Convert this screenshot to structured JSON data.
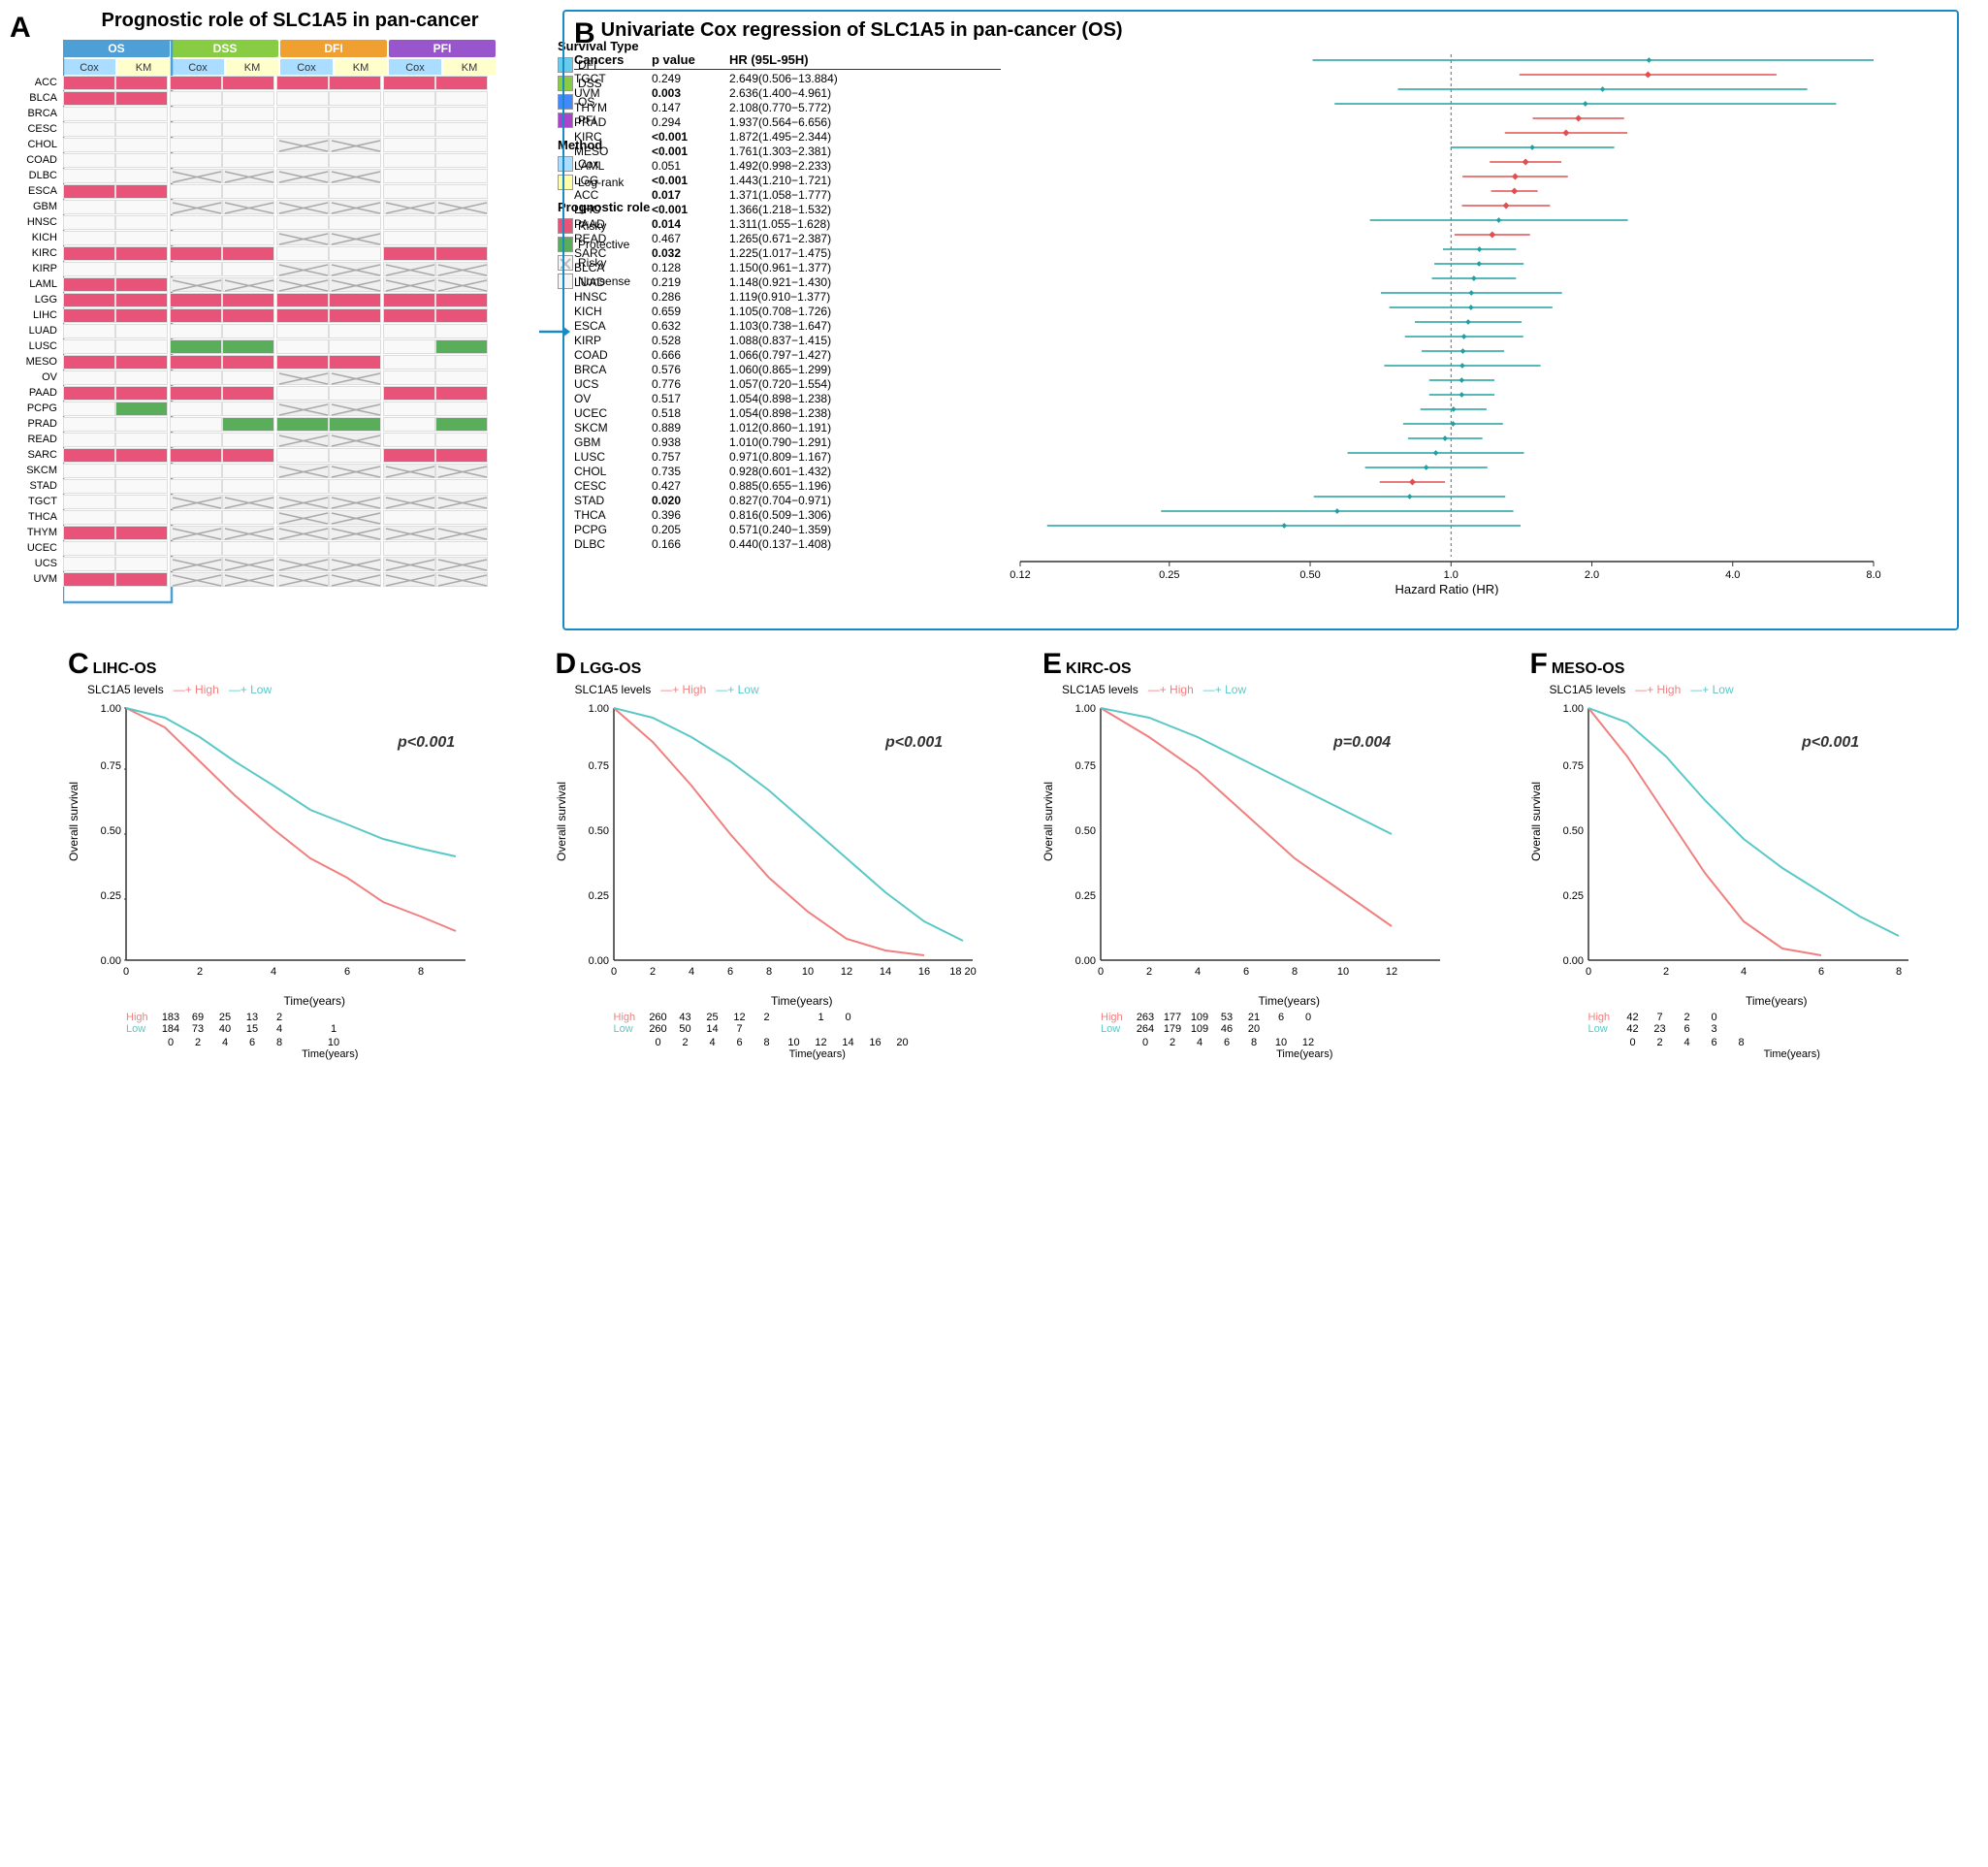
{
  "panelA": {
    "label": "A",
    "title": "Prognostic role of SLC1A5 in pan-cancer",
    "colHeaders": [
      "OS",
      "DSS",
      "DFI",
      "PFI"
    ],
    "subHeaders": [
      "Cox",
      "KM",
      "Cox",
      "KM",
      "Cox",
      "KM",
      "Cox",
      "KM"
    ],
    "rows": [
      {
        "cancer": "ACC",
        "cells": [
          "risky",
          "risky",
          "risky",
          "risky",
          "risky",
          "risky",
          "risky",
          "risky"
        ]
      },
      {
        "cancer": "BLCA",
        "cells": [
          "risky",
          "risky",
          "empty",
          "empty",
          "empty",
          "empty",
          "empty",
          "empty"
        ]
      },
      {
        "cancer": "BRCA",
        "cells": [
          "empty",
          "empty",
          "empty",
          "empty",
          "empty",
          "empty",
          "empty",
          "empty"
        ]
      },
      {
        "cancer": "CESC",
        "cells": [
          "empty",
          "empty",
          "empty",
          "empty",
          "empty",
          "empty",
          "empty",
          "empty"
        ]
      },
      {
        "cancer": "CHOL",
        "cells": [
          "empty",
          "empty",
          "empty",
          "empty",
          "cross",
          "cross",
          "empty",
          "empty"
        ]
      },
      {
        "cancer": "COAD",
        "cells": [
          "empty",
          "empty",
          "empty",
          "empty",
          "empty",
          "empty",
          "empty",
          "empty"
        ]
      },
      {
        "cancer": "DLBC",
        "cells": [
          "empty",
          "empty",
          "cross",
          "cross",
          "cross",
          "cross",
          "empty",
          "empty"
        ]
      },
      {
        "cancer": "ESCA",
        "cells": [
          "risky",
          "risky",
          "empty",
          "empty",
          "empty",
          "empty",
          "empty",
          "empty"
        ]
      },
      {
        "cancer": "GBM",
        "cells": [
          "empty",
          "empty",
          "cross",
          "cross",
          "cross",
          "cross",
          "cross",
          "cross"
        ]
      },
      {
        "cancer": "HNSC",
        "cells": [
          "empty",
          "empty",
          "empty",
          "empty",
          "empty",
          "empty",
          "empty",
          "empty"
        ]
      },
      {
        "cancer": "KICH",
        "cells": [
          "empty",
          "empty",
          "empty",
          "empty",
          "cross",
          "cross",
          "empty",
          "empty"
        ]
      },
      {
        "cancer": "KIRC",
        "cells": [
          "risky",
          "risky",
          "risky",
          "risky",
          "empty",
          "empty",
          "risky",
          "risky"
        ]
      },
      {
        "cancer": "KIRP",
        "cells": [
          "empty",
          "empty",
          "empty",
          "empty",
          "cross",
          "cross",
          "cross",
          "cross"
        ]
      },
      {
        "cancer": "LAML",
        "cells": [
          "risky",
          "risky",
          "cross",
          "cross",
          "cross",
          "cross",
          "cross",
          "cross"
        ]
      },
      {
        "cancer": "LGG",
        "cells": [
          "risky",
          "risky",
          "risky",
          "risky",
          "risky",
          "risky",
          "risky",
          "risky"
        ]
      },
      {
        "cancer": "LIHC",
        "cells": [
          "risky",
          "risky",
          "risky",
          "risky",
          "risky",
          "risky",
          "risky",
          "risky"
        ]
      },
      {
        "cancer": "LUAD",
        "cells": [
          "empty",
          "empty",
          "empty",
          "empty",
          "empty",
          "empty",
          "empty",
          "empty"
        ]
      },
      {
        "cancer": "LUSC",
        "cells": [
          "empty",
          "empty",
          "protective",
          "protective",
          "empty",
          "empty",
          "empty",
          "protective"
        ]
      },
      {
        "cancer": "MESO",
        "cells": [
          "risky",
          "risky",
          "risky",
          "risky",
          "risky",
          "risky",
          "empty",
          "empty"
        ]
      },
      {
        "cancer": "OV",
        "cells": [
          "empty",
          "empty",
          "empty",
          "empty",
          "cross",
          "cross",
          "empty",
          "empty"
        ]
      },
      {
        "cancer": "PAAD",
        "cells": [
          "risky",
          "risky",
          "risky",
          "risky",
          "empty",
          "empty",
          "risky",
          "risky"
        ]
      },
      {
        "cancer": "PCPG",
        "cells": [
          "empty",
          "protective",
          "empty",
          "empty",
          "cross",
          "cross",
          "empty",
          "empty"
        ]
      },
      {
        "cancer": "PRAD",
        "cells": [
          "empty",
          "empty",
          "empty",
          "protective",
          "protective",
          "protective",
          "empty",
          "protective"
        ]
      },
      {
        "cancer": "READ",
        "cells": [
          "empty",
          "empty",
          "empty",
          "empty",
          "cross",
          "cross",
          "empty",
          "empty"
        ]
      },
      {
        "cancer": "SARC",
        "cells": [
          "risky",
          "risky",
          "risky",
          "risky",
          "empty",
          "empty",
          "risky",
          "risky"
        ]
      },
      {
        "cancer": "SKCM",
        "cells": [
          "empty",
          "empty",
          "empty",
          "empty",
          "cross",
          "cross",
          "cross",
          "cross"
        ]
      },
      {
        "cancer": "STAD",
        "cells": [
          "empty",
          "empty",
          "empty",
          "empty",
          "empty",
          "empty",
          "empty",
          "empty"
        ]
      },
      {
        "cancer": "TGCT",
        "cells": [
          "empty",
          "empty",
          "cross",
          "cross",
          "cross",
          "cross",
          "cross",
          "cross"
        ]
      },
      {
        "cancer": "THCA",
        "cells": [
          "empty",
          "empty",
          "empty",
          "empty",
          "cross",
          "cross",
          "empty",
          "empty"
        ]
      },
      {
        "cancer": "THYM",
        "cells": [
          "risky",
          "risky",
          "cross",
          "cross",
          "cross",
          "cross",
          "cross",
          "cross"
        ]
      },
      {
        "cancer": "UCEC",
        "cells": [
          "empty",
          "empty",
          "empty",
          "empty",
          "empty",
          "empty",
          "empty",
          "empty"
        ]
      },
      {
        "cancer": "UCS",
        "cells": [
          "empty",
          "empty",
          "cross",
          "cross",
          "cross",
          "cross",
          "cross",
          "cross"
        ]
      },
      {
        "cancer": "UVM",
        "cells": [
          "risky",
          "risky",
          "cross",
          "cross",
          "cross",
          "cross",
          "cross",
          "cross"
        ]
      }
    ],
    "legendSurvivalType": {
      "title": "Survival Type",
      "items": [
        {
          "label": "DFI",
          "color": "#66ccee"
        },
        {
          "label": "DSS",
          "color": "#88cc44"
        },
        {
          "label": "OS",
          "color": "#4488ff"
        },
        {
          "label": "PFI",
          "color": "#aa44cc"
        }
      ]
    },
    "legendMethod": {
      "title": "Method",
      "items": [
        {
          "label": "Cox",
          "color": "#aaddff"
        },
        {
          "label": "Log-rank",
          "color": "#ffffaa"
        }
      ]
    },
    "legendPrognostic": {
      "title": "Prognostic role",
      "items": [
        {
          "label": "Risky",
          "color": "#e8537a"
        },
        {
          "label": "Protective",
          "color": "#5aad5a"
        },
        {
          "label": "Risky (nonsense border)",
          "color": "#f5f5f5",
          "text": "Risky"
        },
        {
          "label": "Nonsense",
          "color": "#f5f5f5",
          "text": "Nonsense"
        }
      ]
    }
  },
  "panelB": {
    "label": "B",
    "title": "Univariate Cox regression of SLC1A5 in pan-cancer (OS)",
    "headers": {
      "cancer": "Cancers",
      "pvalue": "p value",
      "hr": "HR (95L-95H)"
    },
    "rows": [
      {
        "cancer": "TGCT",
        "pvalue": "0.249",
        "hr": "2.649(0.506−13.884)",
        "sig": false,
        "val": 2.649,
        "low": 0.506,
        "high": 13.884,
        "color": "teal"
      },
      {
        "cancer": "UVM",
        "pvalue": "0.003",
        "hr": "2.636(1.400−4.961)",
        "sig": true,
        "val": 2.636,
        "low": 1.4,
        "high": 4.961,
        "color": "red"
      },
      {
        "cancer": "THYM",
        "pvalue": "0.147",
        "hr": "2.108(0.770−5.772)",
        "sig": false,
        "val": 2.108,
        "low": 0.77,
        "high": 5.772,
        "color": "teal"
      },
      {
        "cancer": "PRAD",
        "pvalue": "0.294",
        "hr": "1.937(0.564−6.656)",
        "sig": false,
        "val": 1.937,
        "low": 0.564,
        "high": 6.656,
        "color": "teal"
      },
      {
        "cancer": "KIRC",
        "pvalue": "<0.001",
        "hr": "1.872(1.495−2.344)",
        "sig": true,
        "val": 1.872,
        "low": 1.495,
        "high": 2.344,
        "color": "red"
      },
      {
        "cancer": "MESO",
        "pvalue": "<0.001",
        "hr": "1.761(1.303−2.381)",
        "sig": true,
        "val": 1.761,
        "low": 1.303,
        "high": 2.381,
        "color": "red"
      },
      {
        "cancer": "LAML",
        "pvalue": "0.051",
        "hr": "1.492(0.998−2.233)",
        "sig": false,
        "val": 1.492,
        "low": 0.998,
        "high": 2.233,
        "color": "teal"
      },
      {
        "cancer": "LGG",
        "pvalue": "<0.001",
        "hr": "1.443(1.210−1.721)",
        "sig": true,
        "val": 1.443,
        "low": 1.21,
        "high": 1.721,
        "color": "red"
      },
      {
        "cancer": "ACC",
        "pvalue": "0.017",
        "hr": "1.371(1.058−1.777)",
        "sig": true,
        "val": 1.371,
        "low": 1.058,
        "high": 1.777,
        "color": "red"
      },
      {
        "cancer": "LIHC",
        "pvalue": "<0.001",
        "hr": "1.366(1.218−1.532)",
        "sig": true,
        "val": 1.366,
        "low": 1.218,
        "high": 1.532,
        "color": "red"
      },
      {
        "cancer": "PAAD",
        "pvalue": "0.014",
        "hr": "1.311(1.055−1.628)",
        "sig": true,
        "val": 1.311,
        "low": 1.055,
        "high": 1.628,
        "color": "red"
      },
      {
        "cancer": "READ",
        "pvalue": "0.467",
        "hr": "1.265(0.671−2.387)",
        "sig": false,
        "val": 1.265,
        "low": 0.671,
        "high": 2.387,
        "color": "teal"
      },
      {
        "cancer": "SARC",
        "pvalue": "0.032",
        "hr": "1.225(1.017−1.475)",
        "sig": true,
        "val": 1.225,
        "low": 1.017,
        "high": 1.475,
        "color": "red"
      },
      {
        "cancer": "BLCA",
        "pvalue": "0.128",
        "hr": "1.150(0.961−1.377)",
        "sig": false,
        "val": 1.15,
        "low": 0.961,
        "high": 1.377,
        "color": "teal"
      },
      {
        "cancer": "LUAD",
        "pvalue": "0.219",
        "hr": "1.148(0.921−1.430)",
        "sig": false,
        "val": 1.148,
        "low": 0.921,
        "high": 1.43,
        "color": "teal"
      },
      {
        "cancer": "HNSC",
        "pvalue": "0.286",
        "hr": "1.119(0.910−1.377)",
        "sig": false,
        "val": 1.119,
        "low": 0.91,
        "high": 1.377,
        "color": "teal"
      },
      {
        "cancer": "KICH",
        "pvalue": "0.659",
        "hr": "1.105(0.708−1.726)",
        "sig": false,
        "val": 1.105,
        "low": 0.708,
        "high": 1.726,
        "color": "teal"
      },
      {
        "cancer": "ESCA",
        "pvalue": "0.632",
        "hr": "1.103(0.738−1.647)",
        "sig": false,
        "val": 1.103,
        "low": 0.738,
        "high": 1.647,
        "color": "teal"
      },
      {
        "cancer": "KIRP",
        "pvalue": "0.528",
        "hr": "1.088(0.837−1.415)",
        "sig": false,
        "val": 1.088,
        "low": 0.837,
        "high": 1.415,
        "color": "teal"
      },
      {
        "cancer": "COAD",
        "pvalue": "0.666",
        "hr": "1.066(0.797−1.427)",
        "sig": false,
        "val": 1.066,
        "low": 0.797,
        "high": 1.427,
        "color": "teal"
      },
      {
        "cancer": "BRCA",
        "pvalue": "0.576",
        "hr": "1.060(0.865−1.299)",
        "sig": false,
        "val": 1.06,
        "low": 0.865,
        "high": 1.299,
        "color": "teal"
      },
      {
        "cancer": "UCS",
        "pvalue": "0.776",
        "hr": "1.057(0.720−1.554)",
        "sig": false,
        "val": 1.057,
        "low": 0.72,
        "high": 1.554,
        "color": "teal"
      },
      {
        "cancer": "OV",
        "pvalue": "0.517",
        "hr": "1.054(0.898−1.238)",
        "sig": false,
        "val": 1.054,
        "low": 0.898,
        "high": 1.238,
        "color": "teal"
      },
      {
        "cancer": "UCEC",
        "pvalue": "0.518",
        "hr": "1.054(0.898−1.238)",
        "sig": false,
        "val": 1.054,
        "low": 0.898,
        "high": 1.238,
        "color": "teal"
      },
      {
        "cancer": "SKCM",
        "pvalue": "0.889",
        "hr": "1.012(0.860−1.191)",
        "sig": false,
        "val": 1.012,
        "low": 0.86,
        "high": 1.191,
        "color": "teal"
      },
      {
        "cancer": "GBM",
        "pvalue": "0.938",
        "hr": "1.010(0.790−1.291)",
        "sig": false,
        "val": 1.01,
        "low": 0.79,
        "high": 1.291,
        "color": "teal"
      },
      {
        "cancer": "LUSC",
        "pvalue": "0.757",
        "hr": "0.971(0.809−1.167)",
        "sig": false,
        "val": 0.971,
        "low": 0.809,
        "high": 1.167,
        "color": "teal"
      },
      {
        "cancer": "CHOL",
        "pvalue": "0.735",
        "hr": "0.928(0.601−1.432)",
        "sig": false,
        "val": 0.928,
        "low": 0.601,
        "high": 1.432,
        "color": "teal"
      },
      {
        "cancer": "CESC",
        "pvalue": "0.427",
        "hr": "0.885(0.655−1.196)",
        "sig": false,
        "val": 0.885,
        "low": 0.655,
        "high": 1.196,
        "color": "teal"
      },
      {
        "cancer": "STAD",
        "pvalue": "0.020",
        "hr": "0.827(0.704−0.971)",
        "sig": true,
        "val": 0.827,
        "low": 0.704,
        "high": 0.971,
        "color": "red"
      },
      {
        "cancer": "THCA",
        "pvalue": "0.396",
        "hr": "0.816(0.509−1.306)",
        "sig": false,
        "val": 0.816,
        "low": 0.509,
        "high": 1.306,
        "color": "teal"
      },
      {
        "cancer": "PCPG",
        "pvalue": "0.205",
        "hr": "0.571(0.240−1.359)",
        "sig": false,
        "val": 0.571,
        "low": 0.24,
        "high": 1.359,
        "color": "teal"
      },
      {
        "cancer": "DLBC",
        "pvalue": "0.166",
        "hr": "0.440(0.137−1.408)",
        "sig": false,
        "val": 0.44,
        "low": 0.137,
        "high": 1.408,
        "color": "teal"
      }
    ],
    "xAxisLabel": "Hazard Ratio (HR)",
    "xTicks": [
      "0.12",
      "0.25",
      "0.50",
      "1.0",
      "2.0",
      "4.0",
      "8.0"
    ]
  },
  "panelC": {
    "label": "C",
    "title": "LIHC-OS",
    "subtitle": "SLC1A5 levels",
    "legendHigh": "High",
    "legendLow": "Low",
    "pval": "p<0.001",
    "yLabel": "Overall survival",
    "xLabel": "Time(years)",
    "xMax": 10,
    "tableRows": [
      {
        "label": "High",
        "color": "#f08080",
        "values": [
          "183",
          "69",
          "25",
          "13",
          "2",
          "",
          ""
        ],
        "times": [
          "0",
          "2",
          "4",
          "6",
          "8",
          "",
          "10"
        ]
      },
      {
        "label": "Low",
        "color": "#5bc8c8",
        "values": [
          "184",
          "73",
          "40",
          "15",
          "4",
          "",
          "1"
        ],
        "times": [
          "0",
          "2",
          "4",
          "6",
          "8",
          "",
          "10"
        ]
      }
    ]
  },
  "panelD": {
    "label": "D",
    "title": "LGG-OS",
    "subtitle": "SLC1A5 levels",
    "legendHigh": "High",
    "legendLow": "Low",
    "pval": "p<0.001",
    "yLabel": "Overall survival",
    "xLabel": "Time(years)",
    "xMax": 20,
    "tableRows": [
      {
        "label": "High",
        "color": "#f08080",
        "values": [
          "260",
          "43",
          "25",
          "12",
          "2",
          "",
          "1"
        ],
        "times": [
          "0",
          "2",
          "4",
          "6",
          "8",
          "10",
          "...",
          "20"
        ]
      },
      {
        "label": "Low",
        "color": "#5bc8c8",
        "values": [
          "260",
          "50",
          "14",
          "7",
          "",
          "",
          ""
        ],
        "times": []
      }
    ]
  },
  "panelE": {
    "label": "E",
    "title": "KIRC-OS",
    "subtitle": "SLC1A5 levels",
    "legendHigh": "High",
    "legendLow": "Low",
    "pval": "p=0.004",
    "yLabel": "Overall survival",
    "xLabel": "Time(years)",
    "xMax": 12,
    "tableRows": [
      {
        "label": "High",
        "color": "#f08080",
        "values": [
          "263",
          "177",
          "109",
          "53",
          "21",
          "6",
          "0"
        ],
        "times": [
          "0",
          "2",
          "4",
          "6",
          "8",
          "10",
          "12"
        ]
      },
      {
        "label": "Low",
        "color": "#5bc8c8",
        "values": [
          "264",
          "179",
          "109",
          "46",
          "20",
          "",
          ""
        ],
        "times": []
      }
    ]
  },
  "panelF": {
    "label": "F",
    "title": "MESO-OS",
    "subtitle": "SLC1A5 levels",
    "legendHigh": "High",
    "legendLow": "Low",
    "pval": "p<0.001",
    "yLabel": "Overall survival",
    "xLabel": "Time(years)",
    "xMax": 8,
    "tableRows": [
      {
        "label": "High",
        "color": "#f08080",
        "values": [
          "42",
          "7",
          "2",
          "0",
          "",
          "",
          ""
        ]
      },
      {
        "label": "Low",
        "color": "#5bc8c8",
        "values": [
          "42",
          "23",
          "6",
          "3",
          "",
          "",
          ""
        ]
      }
    ]
  }
}
